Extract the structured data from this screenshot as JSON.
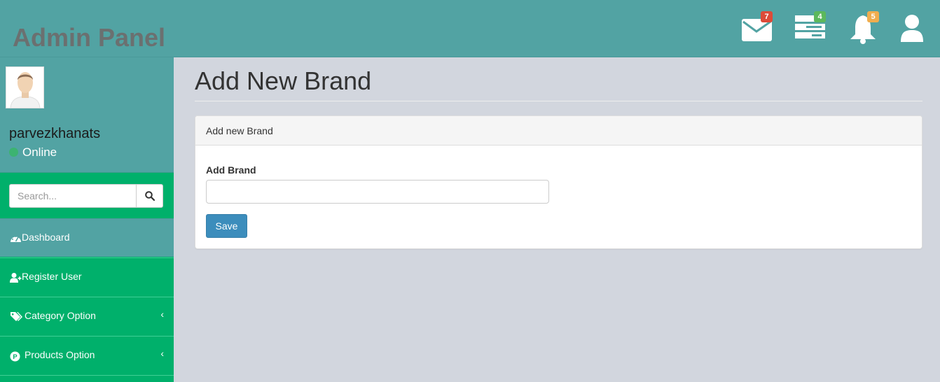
{
  "header": {
    "brand": "Admin Panel",
    "messages_count": "7",
    "tasks_count": "4",
    "notifications_count": "5"
  },
  "sidebar": {
    "username": "parvezkhanats",
    "status": "Online",
    "search_placeholder": "Search...",
    "items": [
      {
        "label": "Dashboard",
        "icon": "dashboard-icon",
        "active": true
      },
      {
        "label": "Register User",
        "icon": "user-plus-icon",
        "active": false
      },
      {
        "label": "Category Option",
        "icon": "tags-icon",
        "active": false,
        "expandable": true
      },
      {
        "label": "Products Option",
        "icon": "product-p-icon",
        "active": false,
        "expandable": true
      }
    ]
  },
  "main": {
    "page_title": "Add New Brand",
    "panel_title": "Add new Brand",
    "field_label": "Add Brand",
    "field_value": "",
    "save_label": "Save"
  },
  "colors": {
    "header_bg": "#52a3a3",
    "sidebar_bg": "#00b06b",
    "content_bg": "#d2d6de",
    "primary_button": "#3c8dbc"
  }
}
